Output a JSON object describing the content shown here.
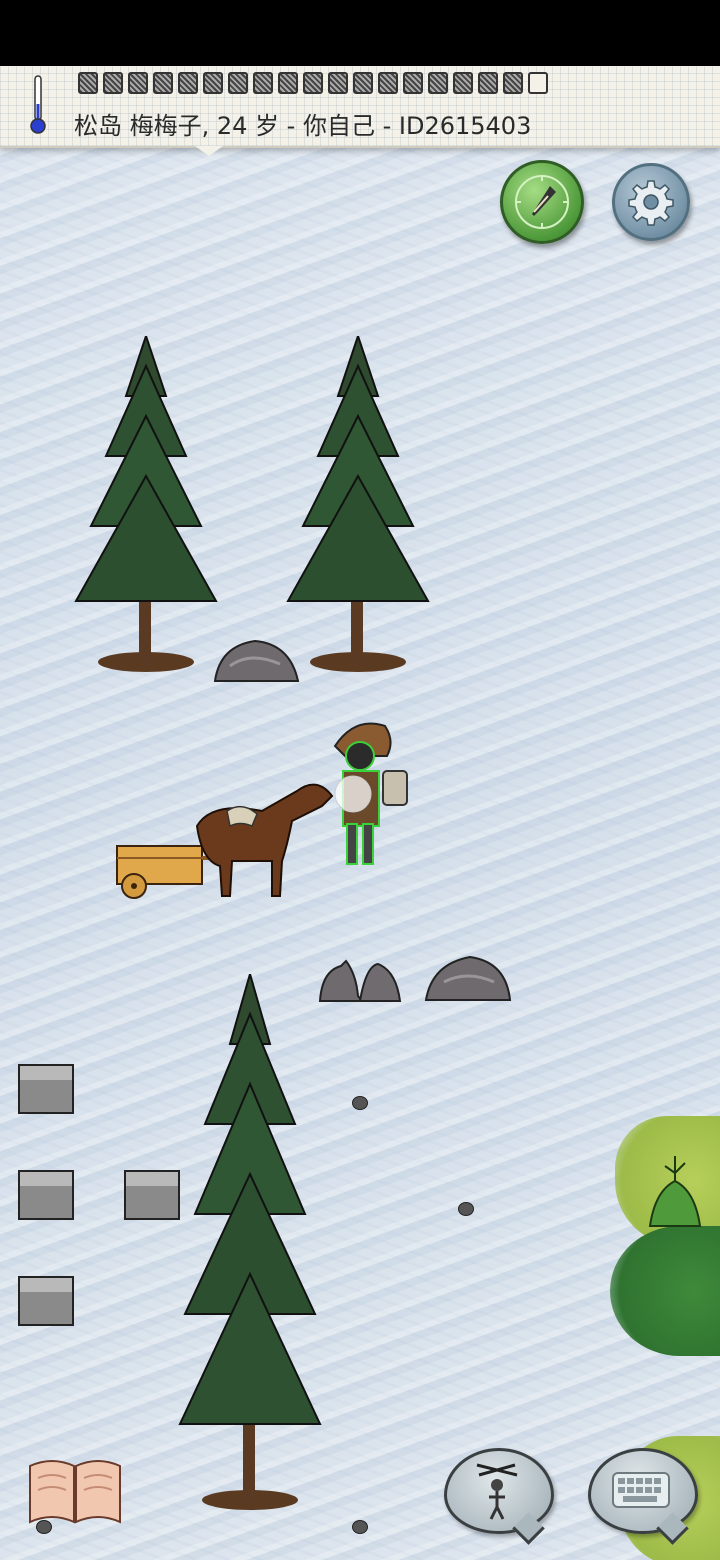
{
  "status_bar": {},
  "hud": {
    "player_label": "松岛 梅梅子, 24 岁 - 你自己 - ID2615403",
    "food_pips_total": 19,
    "food_pips_filled": 18,
    "icons": {
      "temperature": "thermometer-icon",
      "compass": "compass-icon",
      "settings": "gear-icon"
    }
  },
  "world": {
    "terrain": "snow",
    "objects": [
      "pine-tree",
      "pine-tree",
      "pine-tree",
      "boulder",
      "boulder",
      "boulder",
      "horse-cart",
      "player-character",
      "stone-block",
      "stone-block",
      "stone-block",
      "stone-block",
      "small-rock",
      "small-rock",
      "green-bush"
    ]
  },
  "controls": {
    "recipe_book": "book-icon",
    "emote": "puppet-icon",
    "chat": "keyboard-icon"
  },
  "colors": {
    "header_paper": "#f3f1e8",
    "compass_green": "#4e9a3a",
    "settings_blue": "#6f8ea3",
    "snow": "#d8e2ec"
  }
}
